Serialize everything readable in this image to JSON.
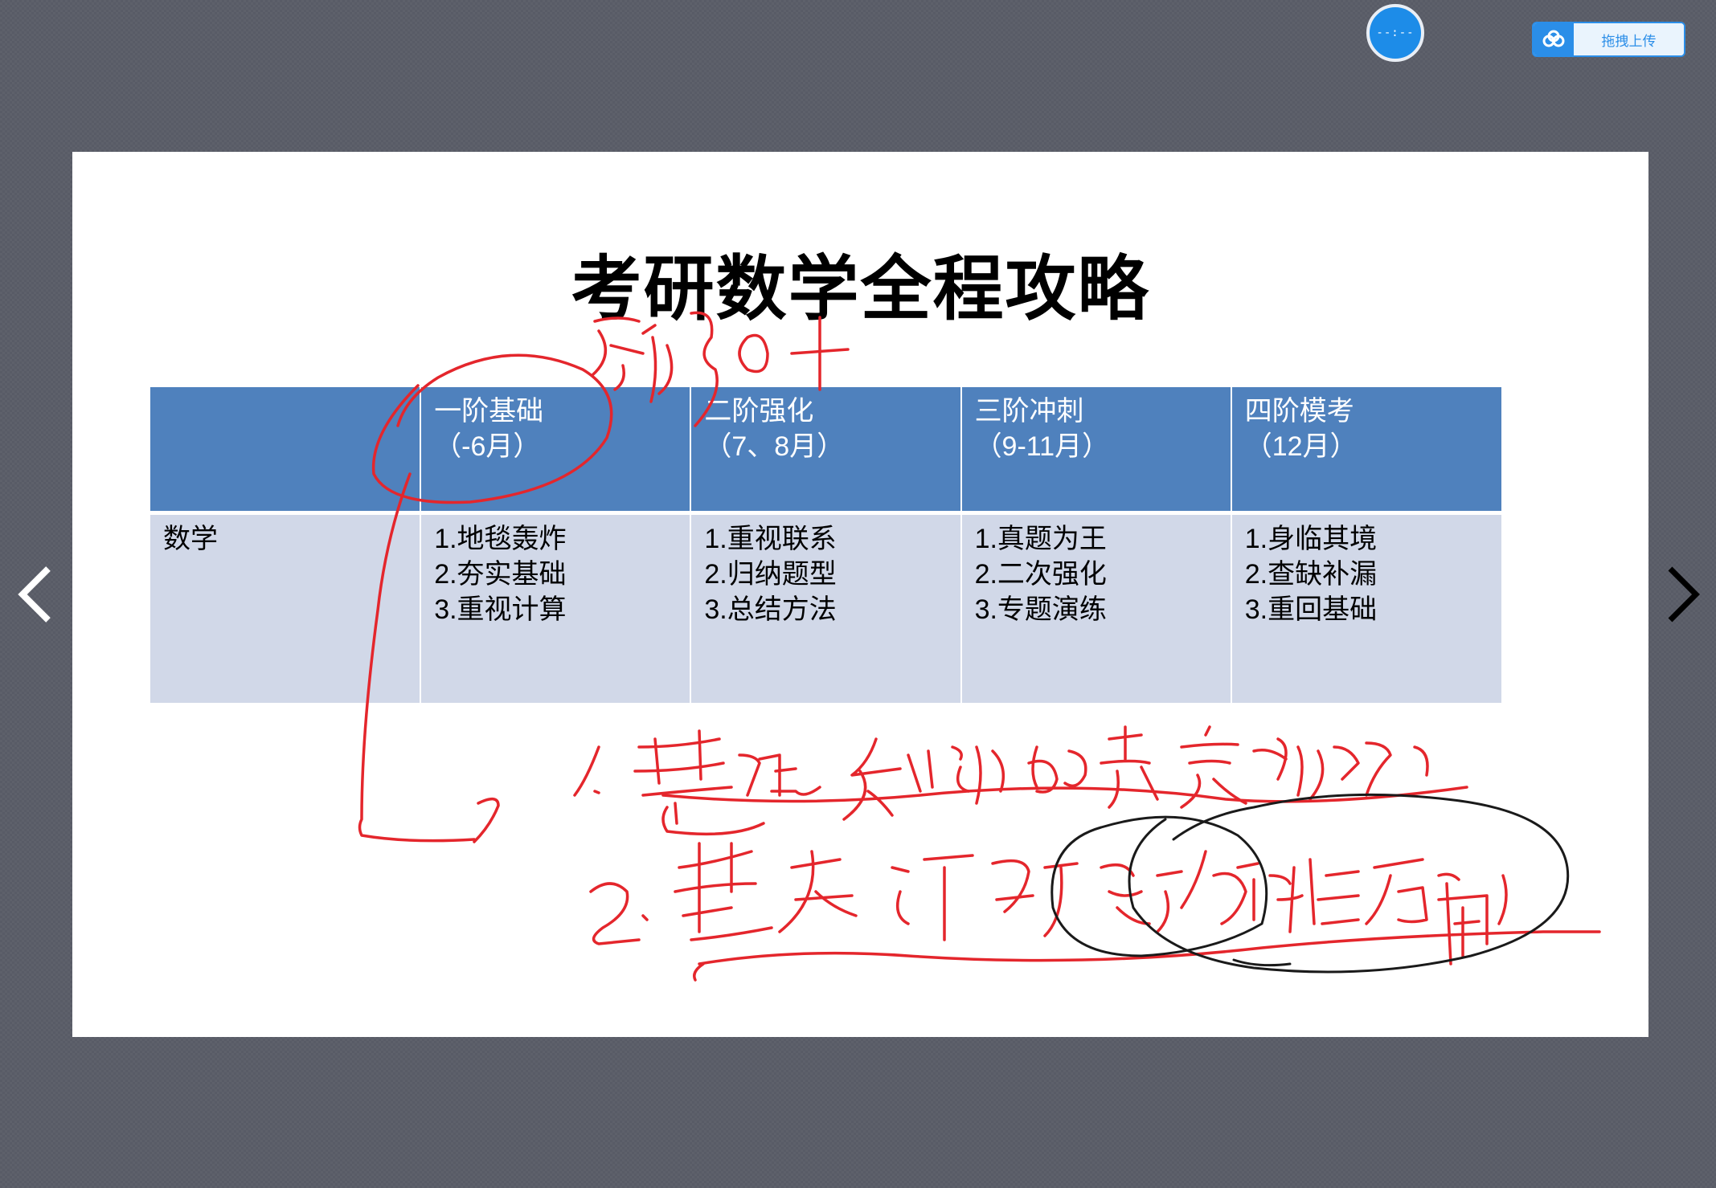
{
  "timer": {
    "text": "--:--"
  },
  "upload_button": {
    "label": "拖拽上传"
  },
  "slide": {
    "title": "考研数学全程攻略",
    "table": {
      "stages": [
        {
          "name": "一阶基础",
          "period": "（-6月）"
        },
        {
          "name": "二阶强化",
          "period": "（7、8月）"
        },
        {
          "name": "三阶冲刺",
          "period": "（9-11月）"
        },
        {
          "name": "四阶模考",
          "period": "（12月）"
        }
      ],
      "row_label": "数学",
      "items": [
        [
          "1.地毯轰炸",
          "2.夯实基础",
          "3.重视计算"
        ],
        [
          "1.重视联系",
          "2.归纳题型",
          "3.总结方法"
        ],
        [
          "1.真题为王",
          "2.二次强化",
          "3.专题演练"
        ],
        [
          "1.身临其境",
          "2.查缺补漏",
          "3.重回基础"
        ]
      ]
    }
  },
  "colors": {
    "header": "#4f81bd",
    "body": "#d1d8e8",
    "ink_red": "#e4262c",
    "ink_black": "#1a1a1a",
    "background": "#585b66",
    "accent_blue": "#2b8ee8"
  }
}
